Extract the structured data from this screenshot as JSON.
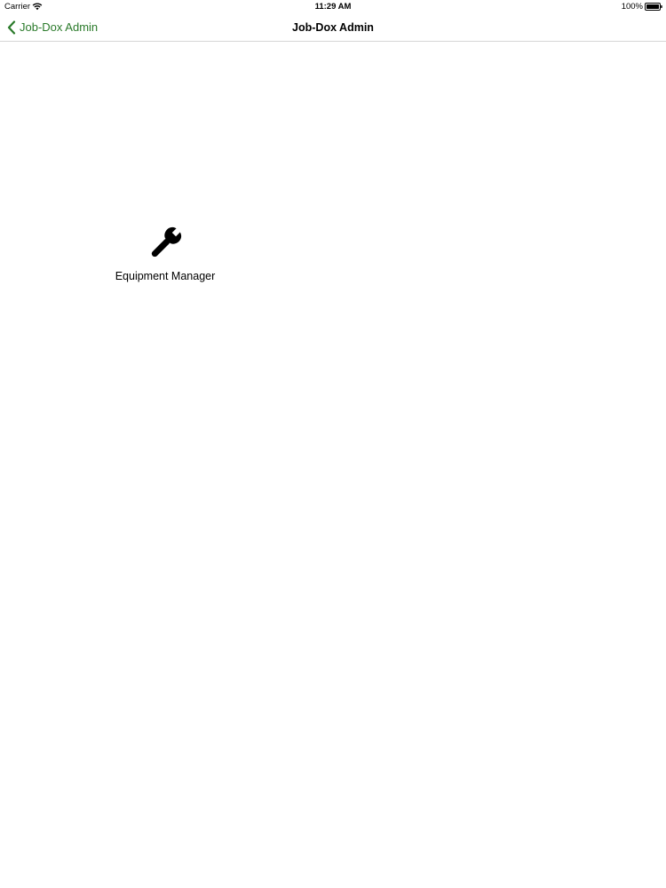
{
  "status_bar": {
    "carrier": "Carrier",
    "time": "11:29 AM",
    "battery": "100%"
  },
  "nav": {
    "back_label": "Job-Dox Admin",
    "title": "Job-Dox Admin",
    "accent_color": "#2a7a2a"
  },
  "tiles": [
    {
      "label": "Equipment Manager",
      "icon": "wrench-icon"
    }
  ]
}
